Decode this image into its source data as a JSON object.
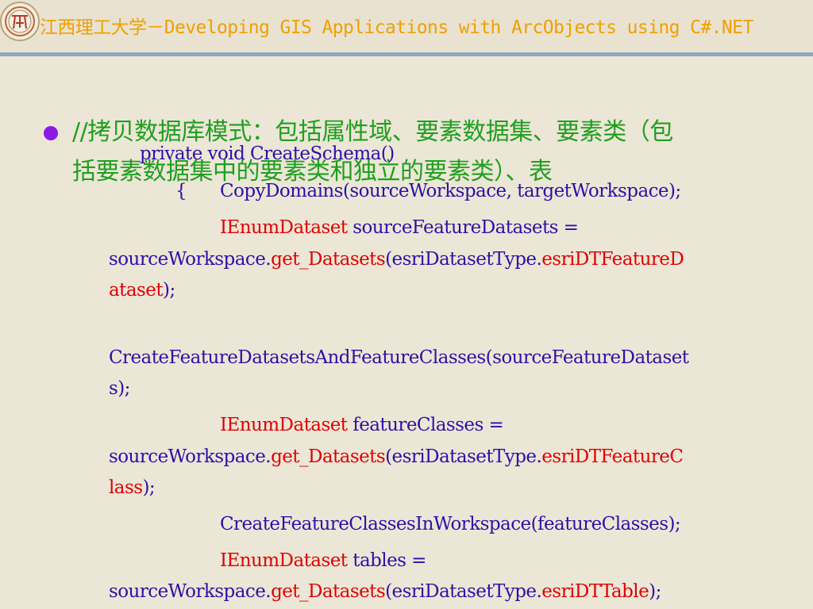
{
  "header": {
    "title": "江西理工大学－Developing GIS Applications with ArcObjects using C#.NET",
    "logo_icon": "university-seal"
  },
  "colors": {
    "background": "#ECE6D6",
    "header_title": "#F0A000",
    "header_rule": "#8FA7BF",
    "bullet": "#8A1BE5",
    "heading_text": "#1F9F1F",
    "code_text": "#2A11A8",
    "code_highlight": "#E00000"
  },
  "bullet": {
    "icon": "filled-circle",
    "lines": [
      "//拷贝数据库模式：包括属性域、要素数据集、要素类（包",
      "括要素数据集中的要素类和独立的要素类）、表"
    ]
  },
  "code": {
    "l1": "private void CreateSchema()",
    "l2_brace": "{",
    "l2": "CopyDomains(sourceWorkspace, targetWorkspace);",
    "l3_type": "IEnumDataset",
    "l3_rest": " sourceFeatureDatasets =",
    "l4_a": "sourceWorkspace.",
    "l4_b": "get_Datasets",
    "l4_c": "(esriDatasetType.",
    "l4_d": "esriDTFeatureD",
    "l5_a": "ataset",
    "l5_b": ");",
    "l6": "CreateFeatureDatasetsAndFeatureClasses(sourceFeatureDataset",
    "l7": "s);",
    "l8_type": "IEnumDataset",
    "l8_rest": " featureClasses =",
    "l9_a": "sourceWorkspace.",
    "l9_b": "get_Datasets",
    "l9_c": "(esriDatasetType.",
    "l9_d": "esriDTFeatureC",
    "l10_a": "lass",
    "l10_b": ");",
    "l11": "CreateFeatureClassesInWorkspace(featureClasses);",
    "l12_type": "IEnumDataset",
    "l12_rest": " tables =",
    "l13_a": "sourceWorkspace.",
    "l13_b": "get_Datasets",
    "l13_c": "(esriDatasetType.",
    "l13_d": "esriDTTable",
    "l13_e": ");"
  }
}
